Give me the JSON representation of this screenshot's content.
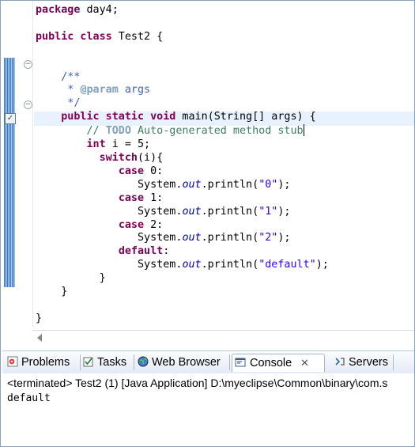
{
  "editor": {
    "lines": [
      "package day4;",
      "",
      "public class Test2 {",
      "",
      "",
      "    /**",
      "     * @param args",
      "     */",
      "    public static void main(String[] args) {",
      "        // TODO Auto-generated method stub",
      "        int i = 5;",
      "        switch(i){",
      "            case 0:",
      "                System.out.println(\"0\");",
      "            case 1:",
      "                System.out.println(\"1\");",
      "            case 2:",
      "                System.out.println(\"2\");",
      "            default:",
      "                System.out.println(\"default\");",
      "        }",
      "    }",
      "",
      "}"
    ]
  },
  "views": {
    "tabs": [
      {
        "label": "Problems",
        "icon": "problems-icon"
      },
      {
        "label": "Tasks",
        "icon": "tasks-icon"
      },
      {
        "label": "Web Browser",
        "icon": "globe-icon"
      },
      {
        "label": "Console",
        "icon": "console-icon"
      },
      {
        "label": "Servers",
        "icon": "servers-icon"
      }
    ],
    "active_tab": "Console"
  },
  "console": {
    "status": "<terminated> Test2 (1) [Java Application] D:\\myeclipse\\Common\\binary\\com.s",
    "output": "default"
  },
  "colors": {
    "keyword": "#7f0055",
    "comment": "#3f7f5f",
    "javadoc": "#3f5fbf",
    "string": "#2a00ff",
    "field": "#0000c0",
    "current_line": "#e8f2fe"
  }
}
